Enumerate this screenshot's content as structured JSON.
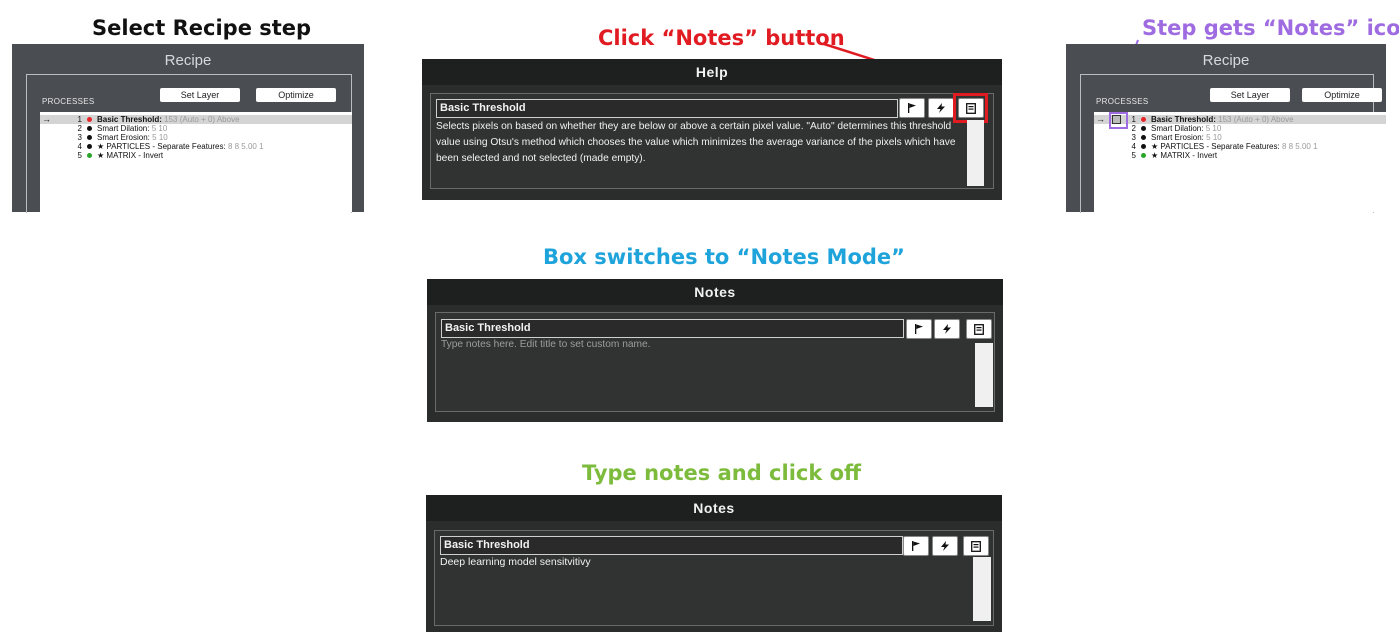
{
  "captions": {
    "select_step": "Select Recipe step",
    "click_notes": "Click “Notes” button",
    "step_gets_icon": "Step gets “Notes” icon",
    "box_switches": "Box switches to “Notes Mode”",
    "type_notes": "Type notes and click off"
  },
  "colors": {
    "click_notes": "#e11b22",
    "step_gets_icon": "#9f6be0",
    "box_switches": "#1ea3db",
    "type_notes": "#7dbb3c"
  },
  "recipe": {
    "title": "Recipe",
    "processes_label": "PROCESSES",
    "set_layer": "Set Layer",
    "optimize": "Optimize",
    "selected_arrow": "→",
    "rows": [
      {
        "num": "1",
        "dot": "#e8262a",
        "name": "Basic Threshold:",
        "detail": "153 (Auto + 0) Above",
        "star": ""
      },
      {
        "num": "2",
        "dot": "#111111",
        "name": "Smart Dilation:",
        "detail": "5 10",
        "star": ""
      },
      {
        "num": "3",
        "dot": "#111111",
        "name": "Smart Erosion:",
        "detail": "5 10",
        "star": ""
      },
      {
        "num": "4",
        "dot": "#111111",
        "name": "PARTICLES - Separate Features:",
        "detail": "8 8 5.00 1",
        "star": "★"
      },
      {
        "num": "5",
        "dot": "#2aa52a",
        "name": "MATRIX - Invert",
        "detail": "",
        "star": "★"
      }
    ]
  },
  "help_dialog": {
    "header": "Help",
    "step_title": "Basic Threshold",
    "text": "Selects pixels on based on whether they are below or above a certain pixel value. \"Auto\" determines this threshold value using Otsu's method which chooses the value which minimizes the average variance of the pixels which have been selected and not selected (made empty)."
  },
  "notes_dialog": {
    "header": "Notes",
    "step_title": "Basic Threshold",
    "placeholder": "Type notes here. Edit title to set custom name."
  },
  "notes_filled_dialog": {
    "header": "Notes",
    "step_title": "Basic Threshold",
    "text": "Deep learning model sensitvitivy"
  },
  "icons": {
    "flag": "flag-icon",
    "bolt": "lightning-icon",
    "notes": "notes-icon"
  }
}
